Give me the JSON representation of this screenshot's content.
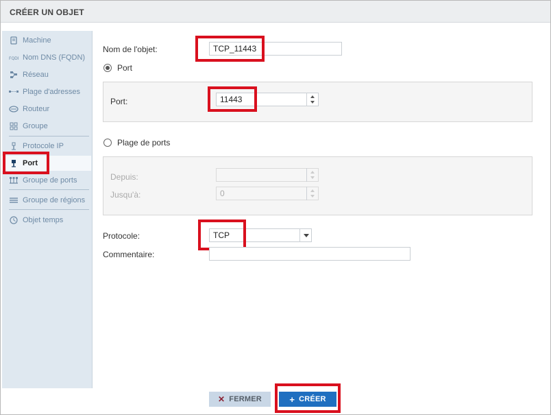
{
  "dialog": {
    "title": "CRÉER UN OBJET"
  },
  "sidebar": {
    "items": [
      {
        "label": "Machine",
        "icon": "machine-icon"
      },
      {
        "label": "Nom DNS (FQDN)",
        "icon": "fqdn-icon"
      },
      {
        "label": "Réseau",
        "icon": "network-icon"
      },
      {
        "label": "Plage d'adresses",
        "icon": "address-range-icon"
      },
      {
        "label": "Routeur",
        "icon": "router-icon"
      },
      {
        "label": "Groupe",
        "icon": "group-icon"
      },
      {
        "label": "Protocole IP",
        "icon": "ip-protocol-icon"
      },
      {
        "label": "Port",
        "icon": "port-icon",
        "active": true
      },
      {
        "label": "Groupe de ports",
        "icon": "port-group-icon"
      },
      {
        "label": "Groupe de régions",
        "icon": "region-group-icon"
      },
      {
        "label": "Objet temps",
        "icon": "time-object-icon"
      }
    ]
  },
  "form": {
    "object_name_label": "Nom de l'objet:",
    "object_name_value": "TCP_11443",
    "port_radio_label": "Port",
    "port_label": "Port:",
    "port_value": "11443",
    "port_range_radio_label": "Plage de ports",
    "from_label": "Depuis:",
    "from_value": "",
    "to_label": "Jusqu'à:",
    "to_value": "0",
    "protocol_label": "Protocole:",
    "protocol_value": "TCP",
    "comment_label": "Commentaire:",
    "comment_value": ""
  },
  "footer": {
    "close_label": "FERMER",
    "create_label": "CRÉER"
  },
  "colors": {
    "highlight": "#d9101e",
    "primary": "#1f6fc0",
    "sidebar_bg": "#dfe8f0"
  }
}
